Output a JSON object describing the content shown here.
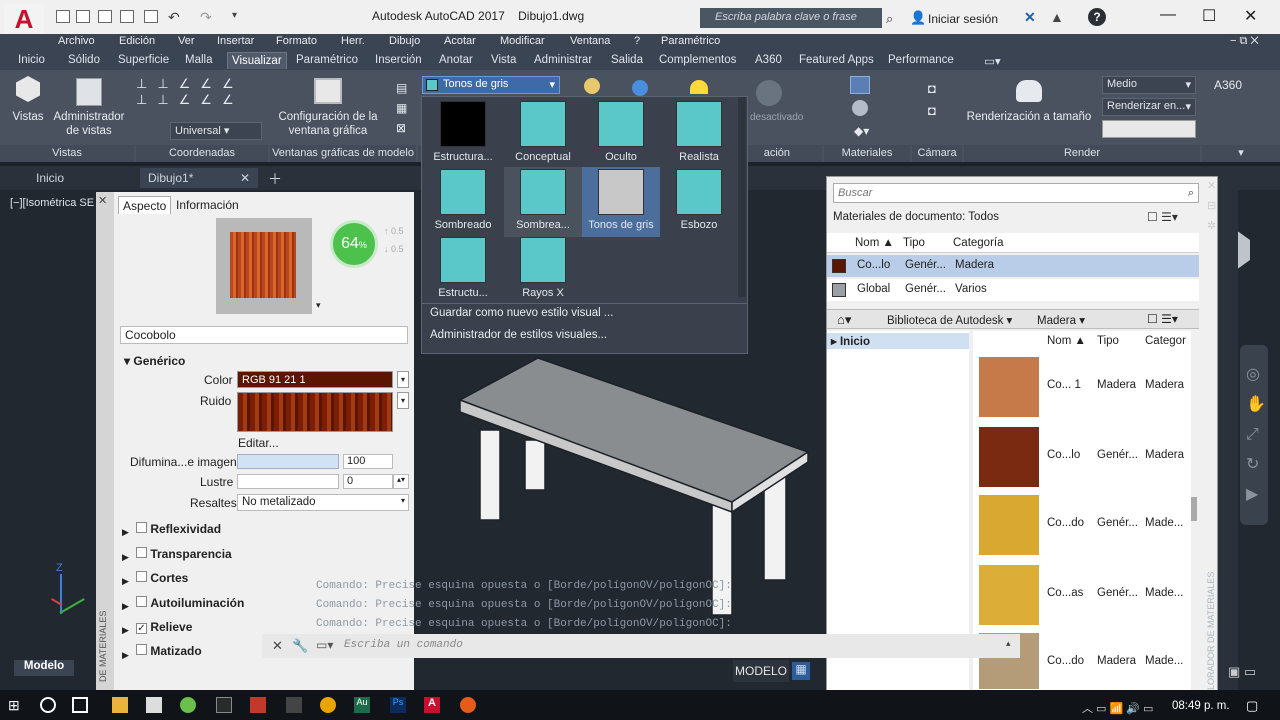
{
  "titlebar": {
    "app_icon": "A",
    "title": "Autodesk AutoCAD 2017",
    "file": "Dibujo1.dwg",
    "search_placeholder": "Escriba palabra clave o frase",
    "login": "Iniciar sesión",
    "help": "?"
  },
  "menubar": [
    "Archivo",
    "Edición",
    "Ver",
    "Insertar",
    "Formato",
    "Herr.",
    "Dibujo",
    "Acotar",
    "Modificar",
    "Ventana",
    "?",
    "Paramétrico"
  ],
  "ribbon_tabs": [
    "Inicio",
    "Sólido",
    "Superficie",
    "Malla",
    "Visualizar",
    "Paramétrico",
    "Inserción",
    "Anotar",
    "Vista",
    "Administrar",
    "Salida",
    "Complementos",
    "A360",
    "Featured Apps",
    "Performance"
  ],
  "active_tab": "Visualizar",
  "ribbon": {
    "vistas": "Vistas",
    "admin_vistas": "Administrador de vistas",
    "coord_universal": "Universal",
    "config_ventana": "Configuración de la ventana gráfica",
    "visual_style": "Tonos de gris",
    "desactivado": "desactivado",
    "render_medio": "Medio",
    "render_en": "Renderizar en...",
    "render_tamano": "Renderización a tamaño",
    "a360": "A360",
    "panels": {
      "vistas": "Vistas",
      "coordenadas": "Coordenadas",
      "ventanas": "Ventanas gráficas de modelo",
      "iluminacion": "ación",
      "materiales": "Materiales",
      "camara": "Cámara",
      "render": "Render"
    }
  },
  "doc_tabs": {
    "inicio": "Inicio",
    "drawing": "Dibujo1*"
  },
  "viewport_label": "[−][Isométrica SE",
  "properties": {
    "tabs": [
      "Aspecto",
      "Información"
    ],
    "percent": "64",
    "percent_unit": "%",
    "side_numbers": [
      "0.5",
      "0.5"
    ],
    "material_name": "Cocobolo",
    "generic": "Genérico",
    "color_label": "Color",
    "color_value": "RGB 91 21 1",
    "ruido_label": "Ruido",
    "editar": "Editar...",
    "difumina_label": "Difumina...e imagen",
    "difumina_value": "100",
    "lustre_label": "Lustre",
    "lustre_value": "0",
    "resaltes_label": "Resaltes",
    "resaltes_value": "No metalizado",
    "sections": [
      {
        "label": "Reflexividad",
        "checked": false
      },
      {
        "label": "Transparencia",
        "checked": false
      },
      {
        "label": "Cortes",
        "checked": false
      },
      {
        "label": "Autoiluminación",
        "checked": false
      },
      {
        "label": "Relieve",
        "checked": true
      },
      {
        "label": "Matizado",
        "checked": false
      }
    ],
    "side_title": "DE MATERIALES"
  },
  "visual_styles": {
    "items": [
      "Estructura...",
      "Conceptual",
      "Oculto",
      "Realista",
      "Sombreado",
      "Sombrea...",
      "Tonos de gris",
      "Esbozo",
      "Estructu...",
      "Rayos X"
    ],
    "selected": "Tonos de gris",
    "save": "Guardar como nuevo estilo visual ...",
    "manager": "Administrador de estilos visuales..."
  },
  "materials_browser": {
    "search_placeholder": "Buscar",
    "doc_materials": "Materiales de documento: Todos",
    "doc_columns": [
      "Nom",
      "Tipo",
      "Categoría"
    ],
    "doc_rows": [
      {
        "name": "Co...lo",
        "type": "Genér...",
        "cat": "Madera",
        "selected": true
      },
      {
        "name": "Global",
        "type": "Genér...",
        "cat": "Varios",
        "selected": false
      }
    ],
    "library": "Biblioteca de Autodesk",
    "library_cat": "Madera",
    "tree_root": "Inicio",
    "lib_columns": [
      "Nom",
      "Tipo",
      "Categor"
    ],
    "lib_rows": [
      {
        "name": "Co... 1",
        "type": "Madera",
        "cat": "Madera",
        "color": "#c67a4a"
      },
      {
        "name": "Co...lo",
        "type": "Genér...",
        "cat": "Madera",
        "color": "#7a2a10"
      },
      {
        "name": "Co...do",
        "type": "Genér...",
        "cat": "Made...",
        "color": "#d8a830"
      },
      {
        "name": "Co...as",
        "type": "Genér...",
        "cat": "Made...",
        "color": "#dcae38"
      },
      {
        "name": "Co...do",
        "type": "Madera",
        "cat": "Made...",
        "color": "#b59c78"
      }
    ],
    "side_title": "LORADOR DE MATERIALES"
  },
  "command": {
    "history": [
      "Comando: Precise esquina opuesta o [Borde/polígonOV/polígonOC]:",
      "Comando: Precise esquina opuesta o [Borde/polígonOV/polígonOC]:",
      "Comando: Precise esquina opuesta o [Borde/polígonOV/polígonOC]:"
    ],
    "placeholder": "Escriba un comando"
  },
  "status": {
    "model": "MODELO",
    "layout_tab": "Modelo"
  },
  "taskbar": {
    "time": "08:49 p. m."
  }
}
